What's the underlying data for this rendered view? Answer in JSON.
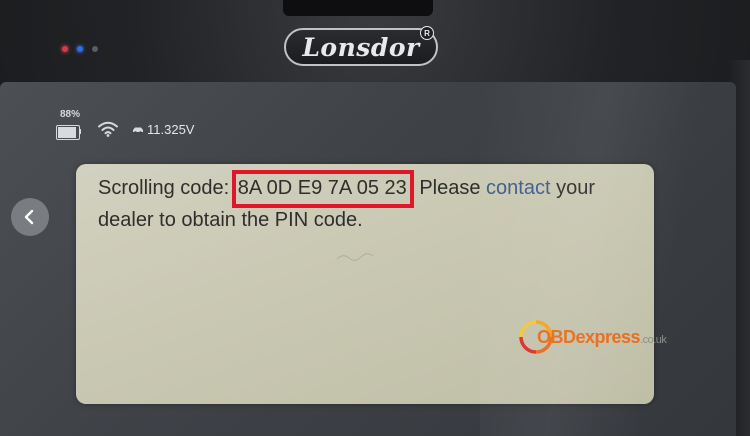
{
  "device": {
    "brand": "Lonsdor",
    "registered_mark": "R"
  },
  "status_bar": {
    "battery_percent_label": "88%",
    "battery_level": 0.88,
    "voltage": "11.325V"
  },
  "dialog": {
    "text_before_code": "Scrolling code: ",
    "scrolling_code": "8A 0D E9 7A 05 23",
    "text_after_code_1": " Please ",
    "contact_word": "contact",
    "text_after_code_2": " your dealer to obtain the PIN code."
  },
  "watermark": {
    "prefix": "OBD",
    "name": "express",
    "tld": ".co.uk"
  },
  "colors": {
    "highlight_box": "#e0162b",
    "dialog_bg": "#c9c8b2",
    "watermark_orange": "#e86b1c"
  },
  "icons": {
    "back": "chevron-left-icon",
    "wifi": "wifi-icon",
    "battery": "battery-icon",
    "car": "car-icon"
  }
}
